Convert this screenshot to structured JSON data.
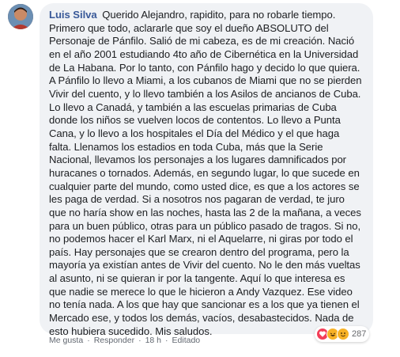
{
  "comment": {
    "author": "Luis Silva",
    "text": "Querido Alejandro, rapidito, para no robarle tiempo. Primero que todo, aclararle que soy el dueño ABSOLUTO del Personaje de Pánfilo. Salió de mi cabeza, es de mi creación. Nació en el año 2001 estudiando 4to año de Cibernética en la Universidad de La Habana. Por lo tanto, con Pánfilo hago y decido lo que quiera. A Pánfilo lo llevo a Miami, a los cubanos de Miami que no se pierden Vivir del cuento, y lo llevo también a los Asilos de ancianos de Cuba. Lo llevo a Canadá, y también a las escuelas primarias de Cuba donde los niños se vuelven locos de contentos. Lo llevo a Punta Cana, y lo llevo a los hospitales el Día del Médico y el que haga falta. Llenamos los estadios en toda Cuba, más que la Serie Nacional, llevamos los personajes a los lugares damnificados por huracanes o tornados. Además, en segundo lugar, lo que sucede en cualquier parte del mundo, como usted dice, es que a los actores se les paga de verdad. Si a nosotros nos pagaran de verdad, te juro que no haría show en las noches, hasta las 2 de la mañana, a veces para un buen público, otras para un público pasado de tragos. Si no, no podemos hacer el Karl Marx, ni el Aquelarre, ni giras por todo el país. Hay personajes que se crearon dentro del programa, pero la mayoría ya existían antes de Vivir del cuento. No le den más vueltas al asunto, ni se quieran ir por la tangente. Aquí lo que interesa es que nadie se merece lo que le hicieron a Andy Vazquez. Ese video no tenía nada. A los que hay que sancionar es a los que ya tienen el Mercado ese, y todos los demás, vacíos, desabastecidos. Nada de esto hubiera sucedido. Mis saludos."
  },
  "reactions": {
    "icons": [
      "heart-icon",
      "haha-icon",
      "laugh-icon"
    ],
    "count": "287"
  },
  "actions": {
    "like": "Me gusta",
    "reply": "Responder",
    "time": "18 h",
    "edited": "Editado",
    "separator": "·"
  },
  "colors": {
    "author": "#385898",
    "bubble": "#f0f2f5",
    "heart": "#f33e58",
    "haha": "#f7b125"
  }
}
